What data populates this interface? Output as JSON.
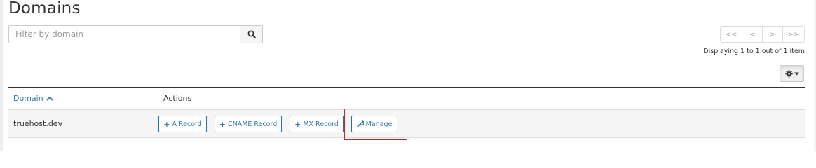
{
  "page": {
    "title": "Domains"
  },
  "search": {
    "placeholder": "Filter by domain",
    "value": "",
    "icon": "search-icon"
  },
  "pagination": {
    "first": "<<",
    "prev": "<",
    "next": ">",
    "last": ">>",
    "summary": "Displaying 1 to 1 out of 1 item"
  },
  "settings": {
    "icon": "gear-icon",
    "caret_icon": "caret-down-icon"
  },
  "table": {
    "columns": {
      "domain": "Domain",
      "actions": "Actions"
    },
    "sort": {
      "column": "domain",
      "direction": "ascending",
      "icon": "chevron-up-icon"
    },
    "rows": [
      {
        "domain": "truehost.dev",
        "actions": {
          "a_record": "A Record",
          "cname_record": "CNAME Record",
          "mx_record": "MX Record",
          "manage": "Manage"
        }
      }
    ]
  },
  "colors": {
    "link": "#337ab7",
    "button_border": "#2e6da4",
    "highlight": "#dd1e1e",
    "row_background": "#f5f5f5"
  }
}
